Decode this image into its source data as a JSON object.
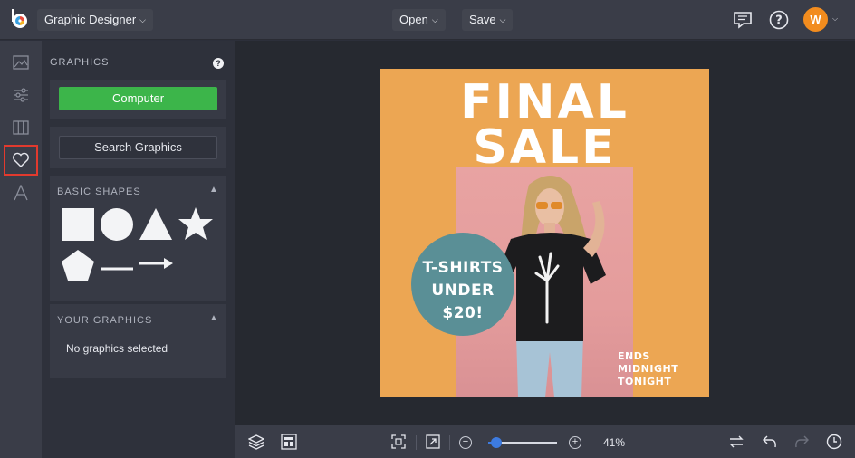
{
  "topbar": {
    "app_title": "Graphic Designer",
    "open_label": "Open",
    "save_label": "Save",
    "user_initial": "W",
    "avatar_color": "#f28c1e"
  },
  "rail": {
    "items": [
      {
        "icon": "image-icon"
      },
      {
        "icon": "adjustments-icon"
      },
      {
        "icon": "frames-icon"
      },
      {
        "icon": "heart-icon",
        "active": true
      },
      {
        "icon": "text-icon"
      }
    ]
  },
  "panel": {
    "heading": "GRAPHICS",
    "computer_label": "Computer",
    "search_label": "Search Graphics",
    "basic_shapes": {
      "title": "BASIC SHAPES",
      "shapes": [
        "square",
        "circle",
        "triangle",
        "star",
        "pentagon",
        "line",
        "arrow"
      ]
    },
    "your_graphics": {
      "title": "YOUR GRAPHICS",
      "empty_text": "No graphics selected"
    }
  },
  "poster": {
    "line1": "FINAL",
    "line2": "SALE",
    "circle_line1": "T-SHIRTS",
    "circle_line2": "UNDER",
    "circle_line3": "$20!",
    "ends_line1": "ENDS",
    "ends_line2": "MIDNIGHT",
    "ends_line3": "TONIGHT",
    "bg_color": "#eca653",
    "circle_color": "#5a8f96"
  },
  "bottombar": {
    "zoom_percent": 41,
    "zoom_label": "41%",
    "accent": "#3d7be0"
  }
}
